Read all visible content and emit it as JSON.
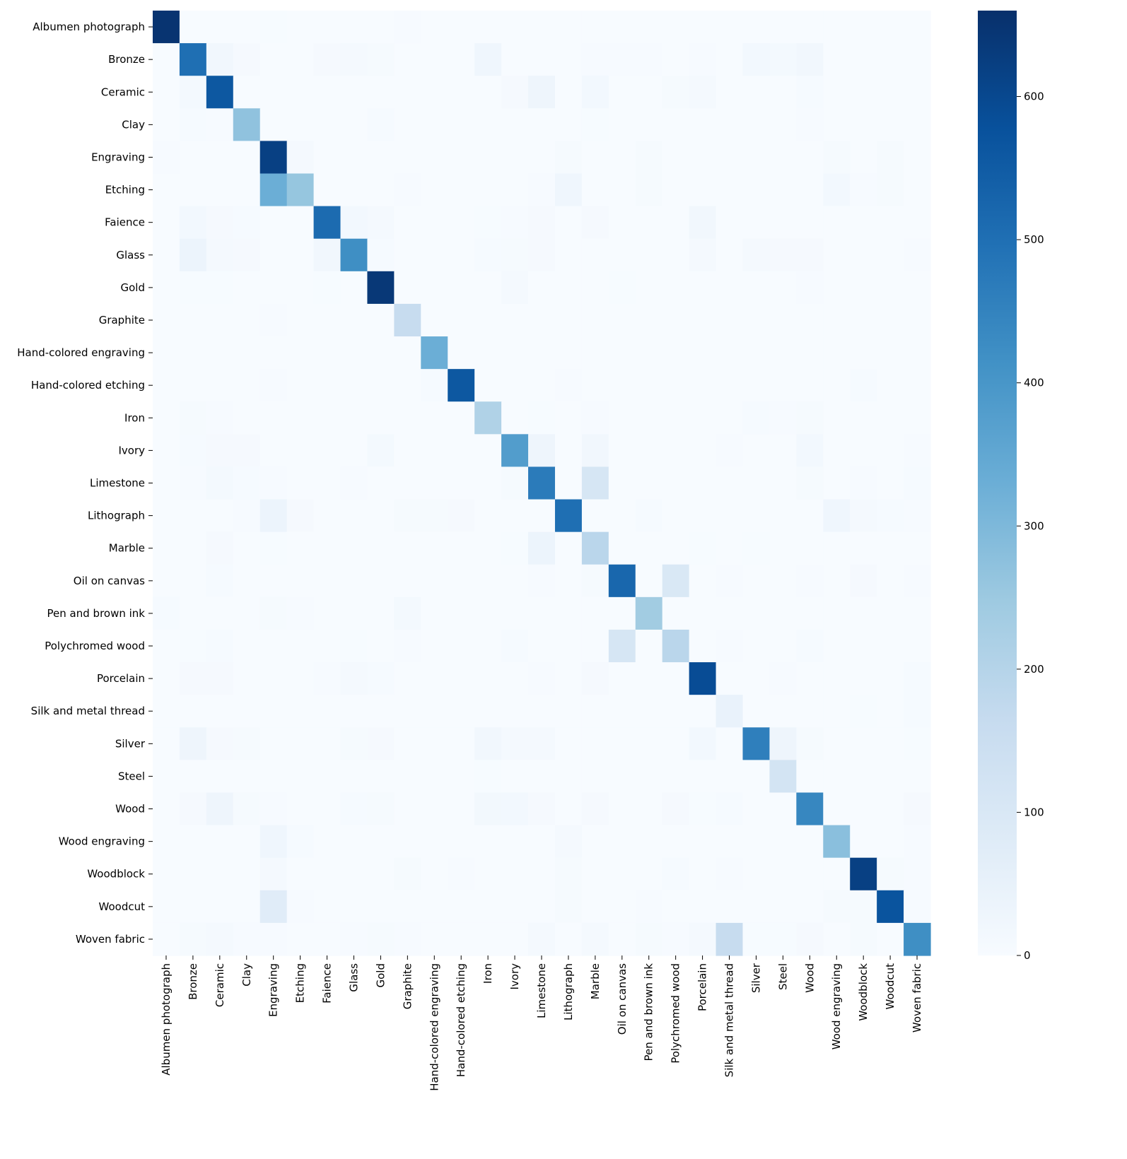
{
  "chart_data": {
    "type": "heatmap",
    "title": "",
    "xlabel": "",
    "ylabel": "",
    "colormap": "Blues",
    "colorbar": {
      "vmin": 0,
      "vmax": 660,
      "ticks": [
        0,
        100,
        200,
        300,
        400,
        500,
        600
      ]
    },
    "labels": [
      "Albumen photograph",
      "Bronze",
      "Ceramic",
      "Clay",
      "Engraving",
      "Etching",
      "Faience",
      "Glass",
      "Gold",
      "Graphite",
      "Hand-colored engraving",
      "Hand-colored etching",
      "Iron",
      "Ivory",
      "Limestone",
      "Lithograph",
      "Marble",
      "Oil on canvas",
      "Pen and brown ink",
      "Polychromed wood",
      "Porcelain",
      "Silk and metal thread",
      "Silver",
      "Steel",
      "Wood",
      "Wood engraving",
      "Woodblock",
      "Woodcut",
      "Woven fabric"
    ],
    "matrix": [
      [
        650,
        0,
        0,
        0,
        2,
        0,
        0,
        0,
        0,
        3,
        0,
        0,
        0,
        0,
        1,
        1,
        1,
        1,
        1,
        1,
        1,
        1,
        1,
        1,
        1,
        1,
        1,
        1,
        1
      ],
      [
        0,
        500,
        20,
        8,
        0,
        0,
        8,
        10,
        6,
        0,
        0,
        0,
        25,
        0,
        0,
        0,
        4,
        4,
        4,
        0,
        4,
        0,
        15,
        12,
        20,
        0,
        0,
        0,
        0
      ],
      [
        0,
        12,
        560,
        0,
        0,
        0,
        0,
        0,
        0,
        0,
        0,
        0,
        0,
        8,
        30,
        0,
        15,
        0,
        0,
        6,
        10,
        0,
        0,
        0,
        5,
        0,
        0,
        0,
        0
      ],
      [
        0,
        5,
        3,
        270,
        0,
        0,
        0,
        0,
        5,
        0,
        0,
        0,
        0,
        0,
        0,
        0,
        2,
        0,
        0,
        0,
        0,
        0,
        0,
        0,
        3,
        0,
        0,
        0,
        0
      ],
      [
        3,
        0,
        0,
        0,
        620,
        10,
        0,
        0,
        0,
        0,
        0,
        0,
        0,
        0,
        0,
        6,
        0,
        0,
        6,
        0,
        0,
        0,
        0,
        0,
        0,
        6,
        0,
        7,
        0
      ],
      [
        0,
        0,
        0,
        0,
        330,
        260,
        0,
        0,
        0,
        3,
        0,
        0,
        0,
        0,
        3,
        25,
        0,
        0,
        6,
        0,
        0,
        0,
        0,
        0,
        0,
        15,
        3,
        6,
        0
      ],
      [
        0,
        15,
        8,
        5,
        0,
        0,
        510,
        15,
        10,
        0,
        0,
        0,
        2,
        3,
        8,
        0,
        8,
        0,
        0,
        0,
        20,
        0,
        0,
        0,
        0,
        0,
        0,
        0,
        0
      ],
      [
        0,
        35,
        10,
        8,
        0,
        0,
        20,
        420,
        5,
        0,
        0,
        0,
        5,
        6,
        8,
        0,
        0,
        0,
        0,
        0,
        10,
        0,
        10,
        8,
        8,
        0,
        0,
        0,
        3
      ],
      [
        0,
        2,
        2,
        1,
        0,
        0,
        2,
        0,
        640,
        0,
        0,
        0,
        0,
        10,
        0,
        0,
        0,
        2,
        0,
        0,
        0,
        0,
        0,
        0,
        3,
        0,
        0,
        0,
        0
      ],
      [
        0,
        0,
        0,
        0,
        3,
        0,
        0,
        0,
        0,
        160,
        0,
        0,
        0,
        0,
        0,
        0,
        0,
        0,
        0,
        0,
        0,
        0,
        0,
        0,
        0,
        0,
        0,
        0,
        0
      ],
      [
        0,
        0,
        0,
        0,
        0,
        0,
        0,
        0,
        0,
        0,
        330,
        0,
        0,
        0,
        0,
        0,
        0,
        0,
        0,
        0,
        0,
        0,
        0,
        0,
        0,
        0,
        0,
        0,
        0
      ],
      [
        0,
        0,
        0,
        0,
        4,
        0,
        0,
        0,
        0,
        0,
        5,
        560,
        0,
        0,
        0,
        4,
        0,
        0,
        0,
        0,
        0,
        0,
        0,
        0,
        0,
        0,
        5,
        0,
        0
      ],
      [
        0,
        6,
        3,
        0,
        0,
        0,
        0,
        0,
        0,
        0,
        0,
        0,
        210,
        0,
        2,
        0,
        3,
        0,
        0,
        0,
        0,
        0,
        5,
        3,
        6,
        0,
        0,
        0,
        0
      ],
      [
        0,
        5,
        8,
        8,
        0,
        0,
        0,
        0,
        12,
        0,
        0,
        0,
        0,
        380,
        30,
        0,
        20,
        0,
        0,
        0,
        0,
        3,
        0,
        0,
        15,
        0,
        0,
        0,
        4
      ],
      [
        0,
        3,
        12,
        5,
        4,
        0,
        0,
        3,
        0,
        0,
        0,
        0,
        0,
        6,
        470,
        0,
        110,
        0,
        0,
        0,
        0,
        0,
        0,
        0,
        6,
        0,
        4,
        0,
        5
      ],
      [
        0,
        0,
        0,
        4,
        35,
        8,
        0,
        0,
        0,
        6,
        6,
        8,
        0,
        0,
        0,
        500,
        0,
        0,
        5,
        0,
        0,
        0,
        0,
        0,
        0,
        25,
        10,
        5,
        4
      ],
      [
        0,
        0,
        8,
        0,
        2,
        0,
        0,
        0,
        0,
        0,
        0,
        0,
        0,
        2,
        35,
        0,
        190,
        0,
        0,
        0,
        2,
        0,
        2,
        0,
        0,
        0,
        0,
        0,
        0
      ],
      [
        0,
        0,
        5,
        0,
        0,
        0,
        0,
        0,
        0,
        0,
        0,
        0,
        0,
        0,
        4,
        0,
        6,
        520,
        0,
        100,
        0,
        3,
        0,
        0,
        3,
        0,
        8,
        0,
        3
      ],
      [
        5,
        0,
        0,
        0,
        6,
        4,
        0,
        0,
        0,
        12,
        0,
        0,
        0,
        0,
        0,
        0,
        0,
        0,
        240,
        0,
        0,
        0,
        0,
        0,
        0,
        0,
        0,
        0,
        0
      ],
      [
        0,
        2,
        5,
        0,
        0,
        0,
        0,
        2,
        0,
        4,
        0,
        0,
        0,
        5,
        0,
        0,
        0,
        110,
        0,
        190,
        0,
        3,
        0,
        0,
        5,
        0,
        0,
        0,
        0
      ],
      [
        0,
        8,
        8,
        0,
        0,
        0,
        3,
        10,
        5,
        0,
        0,
        0,
        0,
        0,
        3,
        0,
        8,
        0,
        0,
        0,
        590,
        0,
        0,
        4,
        0,
        0,
        0,
        0,
        5
      ],
      [
        0,
        0,
        0,
        0,
        0,
        0,
        0,
        0,
        0,
        0,
        0,
        0,
        0,
        0,
        0,
        0,
        0,
        0,
        0,
        0,
        0,
        45,
        0,
        0,
        0,
        0,
        2,
        0,
        5
      ],
      [
        0,
        30,
        8,
        6,
        0,
        0,
        0,
        6,
        8,
        0,
        0,
        0,
        20,
        10,
        10,
        0,
        0,
        0,
        0,
        0,
        15,
        0,
        460,
        30,
        6,
        0,
        0,
        0,
        2
      ],
      [
        0,
        0,
        0,
        0,
        0,
        0,
        0,
        0,
        0,
        0,
        0,
        0,
        2,
        0,
        0,
        0,
        0,
        0,
        0,
        0,
        0,
        0,
        0,
        120,
        0,
        0,
        0,
        0,
        0
      ],
      [
        0,
        8,
        30,
        6,
        3,
        0,
        0,
        5,
        6,
        0,
        0,
        0,
        18,
        15,
        8,
        0,
        8,
        0,
        0,
        8,
        2,
        5,
        0,
        0,
        440,
        0,
        0,
        0,
        8
      ],
      [
        0,
        0,
        0,
        0,
        25,
        5,
        0,
        0,
        0,
        0,
        0,
        0,
        0,
        0,
        0,
        10,
        0,
        0,
        0,
        0,
        0,
        0,
        0,
        0,
        0,
        280,
        0,
        0,
        3
      ],
      [
        0,
        0,
        0,
        0,
        10,
        0,
        0,
        0,
        0,
        6,
        0,
        4,
        0,
        0,
        0,
        6,
        0,
        0,
        0,
        5,
        0,
        3,
        0,
        0,
        0,
        0,
        620,
        6,
        3
      ],
      [
        0,
        0,
        0,
        0,
        75,
        4,
        0,
        0,
        0,
        0,
        0,
        0,
        0,
        0,
        0,
        6,
        0,
        0,
        3,
        0,
        0,
        0,
        0,
        0,
        0,
        6,
        6,
        570,
        4
      ],
      [
        0,
        6,
        10,
        3,
        3,
        0,
        0,
        3,
        6,
        3,
        0,
        0,
        0,
        0,
        10,
        0,
        10,
        0,
        6,
        3,
        10,
        160,
        2,
        2,
        8,
        0,
        6,
        0,
        420
      ]
    ]
  }
}
